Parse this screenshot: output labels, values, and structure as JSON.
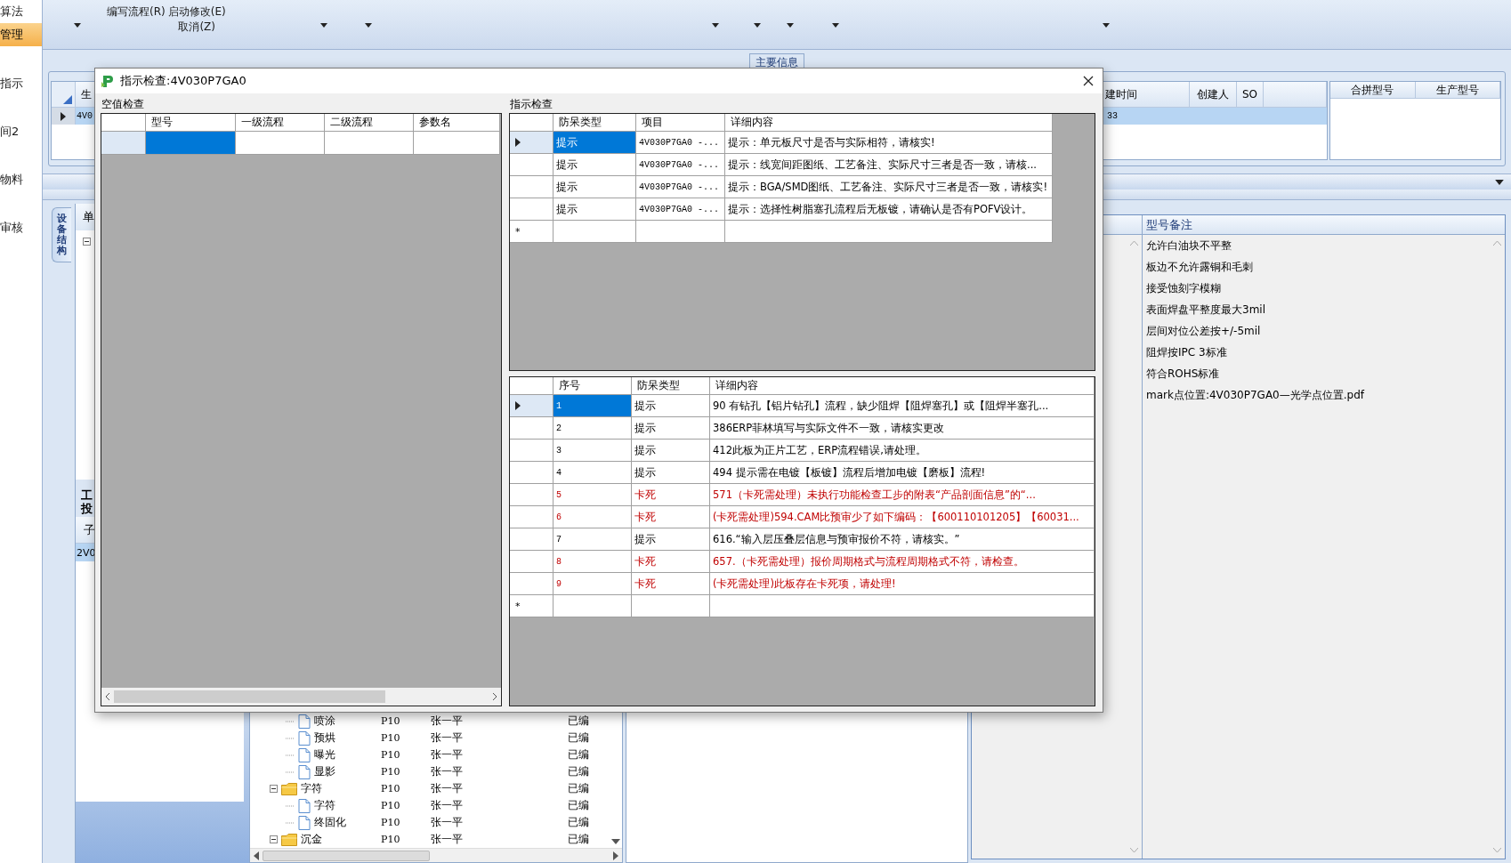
{
  "sidebar": {
    "items": [
      {
        "label": "算法",
        "selected": false
      },
      {
        "label": "管理",
        "selected": true
      },
      {
        "label": "指示",
        "selected": false
      },
      {
        "label": "间2",
        "selected": false
      },
      {
        "label": "物料",
        "selected": false
      },
      {
        "label": "审核",
        "selected": false
      }
    ]
  },
  "toolbar": {
    "items": [
      {
        "caret": true
      },
      {
        "label": "编写流程(R)",
        "caret": false
      },
      {
        "label": "启动修改(E)",
        "label2": "取消(Z)",
        "caret": false
      },
      {
        "caret": true
      },
      {
        "caret": true
      },
      {
        "caret": true
      },
      {
        "caret": true
      },
      {
        "caret": true
      },
      {
        "caret": true
      },
      {
        "caret": true
      }
    ]
  },
  "main_info": {
    "tab": "主要信息",
    "columns": [
      "生",
      "建时间",
      "创建人",
      "SO"
    ],
    "rows": [
      {
        "cells": [
          "4V0",
          "33"
        ],
        "selected": true
      }
    ],
    "side_columns": [
      "合拼型号",
      "生产型号"
    ]
  },
  "left_panel": {
    "vertical_tab": "设备结构",
    "header": "单",
    "section_lines": [
      "工",
      "投"
    ],
    "grid_header": "子",
    "grid_rows": [
      {
        "text": "2V0",
        "selected": true
      }
    ]
  },
  "tree": {
    "items": [
      {
        "name": "喷涂",
        "kind": "file",
        "code": "P10",
        "owner": "张一平",
        "status": "已编"
      },
      {
        "name": "预烘",
        "kind": "file",
        "code": "P10",
        "owner": "张一平",
        "status": "已编"
      },
      {
        "name": "曝光",
        "kind": "file",
        "code": "P10",
        "owner": "张一平",
        "status": "已编"
      },
      {
        "name": "显影",
        "kind": "file",
        "code": "P10",
        "owner": "张一平",
        "status": "已编"
      },
      {
        "name": "字符",
        "kind": "folder",
        "expanded": true,
        "code": "P10",
        "owner": "张一平",
        "status": "已编",
        "children": [
          {
            "name": "字符",
            "kind": "file",
            "code": "P10",
            "owner": "张一平",
            "status": "已编"
          },
          {
            "name": "终固化",
            "kind": "file",
            "code": "P10",
            "owner": "张一平",
            "status": "已编"
          }
        ]
      },
      {
        "name": "沉金",
        "kind": "folder",
        "expanded": true,
        "code": "P10",
        "owner": "张一平",
        "status": "已编"
      }
    ]
  },
  "remarks": {
    "header": "型号备注",
    "items": [
      "允许白油块不平整",
      "板边不允许露铜和毛刺",
      "接受蚀刻字模糊",
      "表面焊盘平整度最大3mil",
      "层间对位公差按+/-5mil",
      "阻焊按IPC 3标准",
      "符合ROHS标准",
      "mark点位置:4V030P7GA0—光学点位置.pdf"
    ]
  },
  "dialog": {
    "title": "指示检查:4V030P7GA0",
    "null_check": {
      "title": "空值检查",
      "columns": [
        "型号",
        "一级流程",
        "二级流程",
        "参数名"
      ],
      "rows": [
        {
          "selected": true
        }
      ]
    },
    "indicator_check": {
      "title": "指示检查",
      "columns": [
        "防呆类型",
        "项目",
        "详细内容"
      ],
      "new_row": "*",
      "rows": [
        {
          "type": "提示",
          "item": "4V030P7GA0 -...",
          "detail": "提示：单元板尺寸是否与实际相符，请核实!",
          "selected": true
        },
        {
          "type": "提示",
          "item": "4V030P7GA0 -...",
          "detail": "提示：线宽间距图纸、工艺备注、实际尺寸三者是否一致，请核...",
          "selected": false
        },
        {
          "type": "提示",
          "item": "4V030P7GA0 -...",
          "detail": "提示：BGA/SMD图纸、工艺备注、实际尺寸三者是否一致，请核实!",
          "selected": false
        },
        {
          "type": "提示",
          "item": "4V030P7GA0 -...",
          "detail": "提示：选择性树脂塞孔流程后无板镀，请确认是否有POFV设计。",
          "selected": false
        }
      ]
    },
    "results": {
      "columns": [
        "序号",
        "防呆类型",
        "详细内容"
      ],
      "new_row": "*",
      "rows": [
        {
          "no": "1",
          "type": "提示",
          "detail": "90 有钻孔【铝片钻孔】流程，缺少阻焊【阻焊塞孔】或【阻焊半塞孔...",
          "color": "#000000",
          "selected": true
        },
        {
          "no": "2",
          "type": "提示",
          "detail": "386ERP菲林填写与实际文件不一致，请核实更改",
          "color": "#000000",
          "selected": false
        },
        {
          "no": "3",
          "type": "提示",
          "detail": "412此板为正片工艺，ERP流程错误,请处理。",
          "color": "#000000",
          "selected": false
        },
        {
          "no": "4",
          "type": "提示",
          "detail": "494 提示需在电镀【板镀】流程后增加电镀【磨板】流程!",
          "color": "#000000",
          "selected": false
        },
        {
          "no": "5",
          "type": "卡死",
          "detail": "571（卡死需处理）未执行功能检查工步的附表“产品剖面信息”的“...",
          "color": "#c00000",
          "selected": false
        },
        {
          "no": "6",
          "type": "卡死",
          "detail": "(卡死需处理)594.CAM比预审少了如下编码：【600110101205】【60031...",
          "color": "#c00000",
          "selected": false
        },
        {
          "no": "7",
          "type": "提示",
          "detail": "616.“输入层压叠层信息与预审报价不符，请核实。”",
          "color": "#000000",
          "selected": false
        },
        {
          "no": "8",
          "type": "卡死",
          "detail": "657.（卡死需处理）报价周期格式与流程周期格式不符，请检查。",
          "color": "#c00000",
          "selected": false
        },
        {
          "no": "9",
          "type": "卡死",
          "detail": "(卡死需处理)此板存在卡死项，请处理!",
          "color": "#c00000",
          "selected": false
        }
      ]
    }
  }
}
